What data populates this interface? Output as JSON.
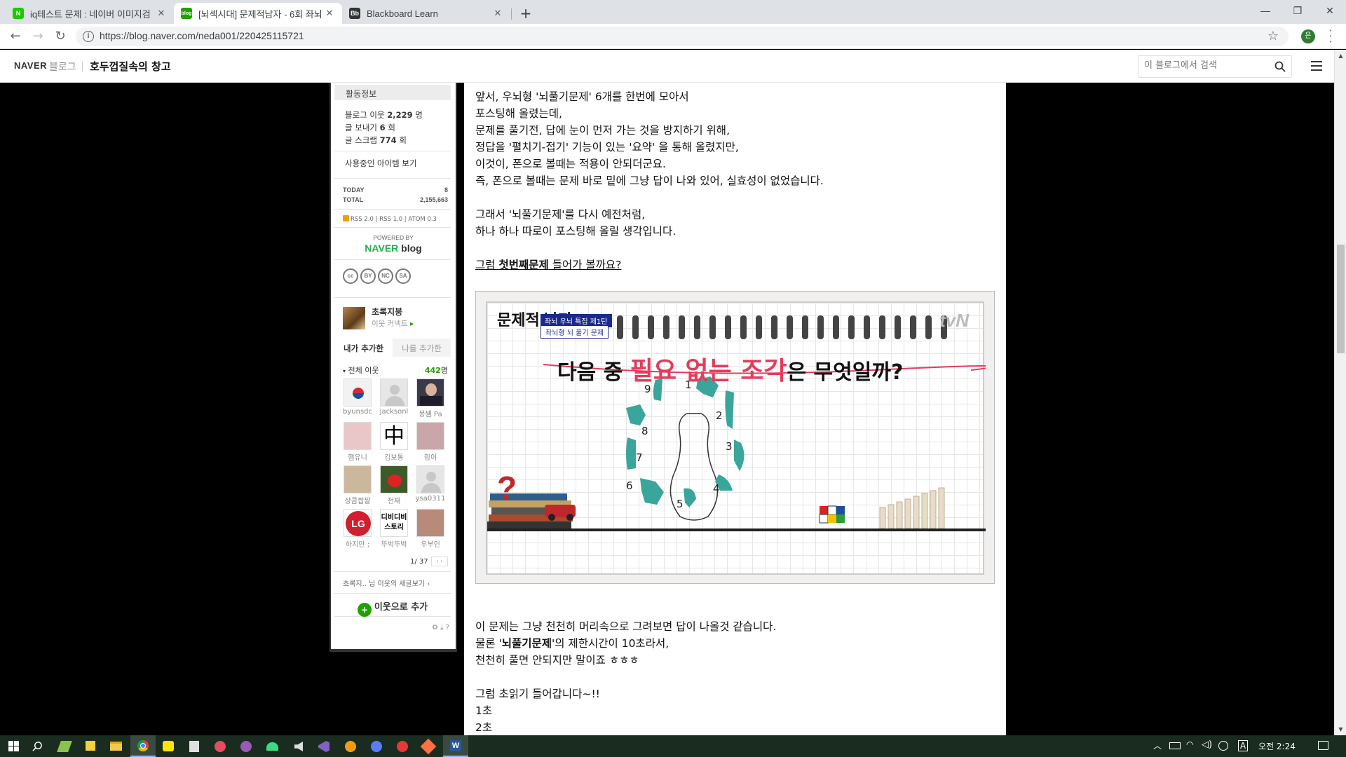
{
  "browser": {
    "tabs": [
      {
        "title": "iq테스트 문제 : 네이버 이미지검",
        "favicon": "N",
        "favicon_color": "#1ec800",
        "active": false
      },
      {
        "title": "[뇌섹시대] 문제적남자 - 6회 좌뇌",
        "favicon": "blog",
        "favicon_color": "#22a000",
        "active": true
      },
      {
        "title": "Blackboard Learn",
        "favicon": "Bb",
        "favicon_color": "#333333",
        "active": false
      }
    ],
    "url": "https://blog.naver.com/neda001/220425115721",
    "profile_initial": "은"
  },
  "blog_header": {
    "naver_logo": "NAVER",
    "blog_word": "블로그",
    "title": "호두껍질속의 창고",
    "search_placeholder": "이 블로그에서 검색"
  },
  "sidebar": {
    "activity_title": "활동정보",
    "stats": [
      {
        "label": "블로그 이웃",
        "value": "2,229",
        "unit": "명"
      },
      {
        "label": "글 보내기",
        "value": "6",
        "unit": "회"
      },
      {
        "label": "글 스크랩",
        "value": "774",
        "unit": "회"
      }
    ],
    "items_link": "사용중인 아이템 보기",
    "today_label": "TODAY",
    "today_value": "8",
    "total_label": "TOTAL",
    "total_value": "2,155,663",
    "rss": "RSS 2.0 | RSS 1.0 | ATOM 0.3",
    "powered_by": "POWERED BY",
    "naver_blog_logo_a": "NAVER",
    "naver_blog_logo_b": "blog",
    "cc_icons": [
      "cc",
      "BY",
      "NC",
      "SA"
    ],
    "buddy": {
      "name": "초록지붕",
      "sub": "이웃 커넥트"
    },
    "tab_mine": "내가 추가한",
    "tab_them": "나를 추가한",
    "all_neighbors": "전체 이웃",
    "neighbor_count": "442",
    "neighbor_unit": "명",
    "neighbors": [
      {
        "name": "byunsdc",
        "color": "#f2f2f2"
      },
      {
        "name": "jacksonl",
        "color": "#e6e6e6"
      },
      {
        "name": "몽쌤 Pa",
        "color": "#3a3a4a"
      },
      {
        "name": "햄유니",
        "color": "#e9c7c9"
      },
      {
        "name": "김보통",
        "color": "#ffffff"
      },
      {
        "name": "링이",
        "color": "#c9a6a9"
      },
      {
        "name": "상콤짭짤",
        "color": "#cbb79b"
      },
      {
        "name": "천재",
        "color": "#3e5a2a"
      },
      {
        "name": "ysa0311",
        "color": "#e6e6e6"
      },
      {
        "name": "하지만 ;",
        "color": "#d01f2f"
      },
      {
        "name": "뚜벅뚜벅",
        "color": "#ffffff"
      },
      {
        "name": "우부인",
        "color": "#b88a7a"
      }
    ],
    "pager": "1/ 37",
    "buddy_news": "초록지.. 님 이웃의 새글보기",
    "add_neighbor": "이웃으로 추가",
    "tools": "⚙ ⤓ ?"
  },
  "post": {
    "lines_top": [
      "앞서, 우뇌형 '뇌풀기문제' 6개를 한번에 모아서",
      "포스팅해 올렸는데,",
      "문제를 풀기전, 답에 눈이 먼저 가는 것을 방지하기 위해,",
      "정답을 '펼치기-접기' 기능이 있는 '요약' 을 통해 올렸지만,",
      "이것이, 폰으로 볼때는 적용이 안되더군요.",
      "즉, 폰으로 볼때는 문제 바로 밑에 그냥 답이 나와 있어, 실효성이 없었습니다."
    ],
    "lines_mid": [
      "그래서 '뇌풀기문제'를 다시  예전처럼,",
      "하나 하나 따로이 포스팅해 올릴 생각입니다."
    ],
    "line_cta_pre": "그럼 ",
    "line_cta_bold": "첫번째문제",
    "line_cta_post": " 들어가 볼까요?",
    "quiz_image": {
      "show_logo": "문제적 남자",
      "badge1": "좌뇌 우뇌 특집 제1탄",
      "badge2": "좌뇌형 뇌 풀기 문제",
      "channel": "tvN",
      "question_pre": "다음 중 ",
      "question_hl": "필요 없는 조각",
      "question_post": "은 무엇일까?",
      "piece_numbers": [
        "1",
        "2",
        "3",
        "4",
        "5",
        "6",
        "7",
        "8",
        "9"
      ],
      "accent_color": "#3aa69b"
    },
    "line_after1": "이 문제는 그냥 천천히 머리속으로 그려보면 답이 나올것 같습니다.",
    "line_after2_pre": "물론 '",
    "line_after2_bold": "뇌풀기문제",
    "line_after2_post": "'의 제한시간이 10초라서,",
    "line_after3": "천천히 풀면 안되지만 말이죠 ㅎㅎㅎ",
    "line_after4": "그럼 초읽기 들어갑니다~!!",
    "countdown": [
      "1초",
      "2초"
    ]
  },
  "taskbar": {
    "time": "오전 2:24",
    "lang": "A"
  }
}
